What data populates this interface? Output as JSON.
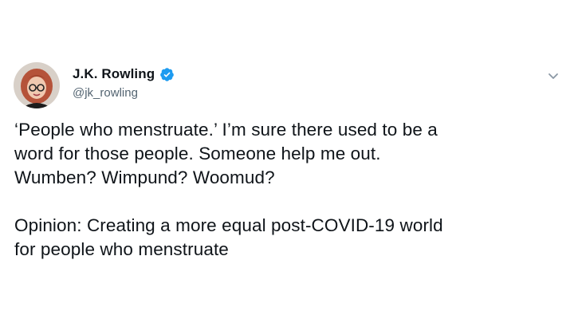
{
  "author": {
    "display_name": "J.K. Rowling",
    "handle": "@jk_rowling",
    "verified": true,
    "verified_icon": "verified-badge-icon",
    "avatar_icon": "profile-avatar"
  },
  "tweet": {
    "paragraph_1": "‘People who menstruate.’ I’m sure there used to be a\nword for those people. Someone help me out.\nWumben? Wimpund? Woomud?",
    "paragraph_2": "Opinion: Creating a more equal post-COVID-19 world\nfor people who menstruate"
  },
  "menu": {
    "icon": "chevron-down-icon"
  },
  "colors": {
    "text_primary": "#0f1419",
    "text_secondary": "#536471",
    "verified_blue": "#1d9bf0",
    "background": "#ffffff"
  }
}
